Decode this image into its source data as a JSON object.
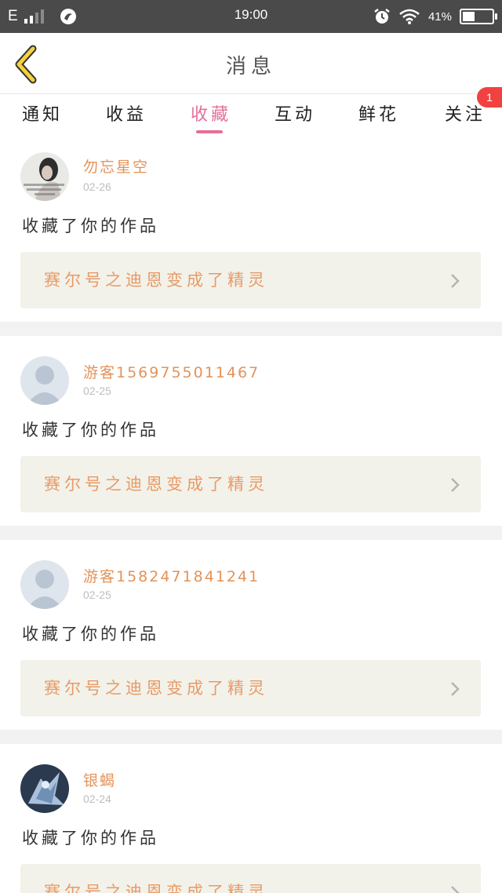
{
  "status_bar": {
    "network": "E",
    "time": "19:00",
    "battery_pct": "41%",
    "battery_level": 0.41,
    "icons": [
      "signal-icon",
      "app-icon",
      "alarm-icon",
      "wifi-icon",
      "battery-icon"
    ]
  },
  "header": {
    "title": "消息",
    "back_icon": "chevron-left-icon"
  },
  "tabs": [
    {
      "label": "通知"
    },
    {
      "label": "收益"
    },
    {
      "label": "收藏"
    },
    {
      "label": "互动"
    },
    {
      "label": "鲜花"
    },
    {
      "label": "关注"
    }
  ],
  "active_tab": "收藏",
  "badge": "1",
  "messages": [
    {
      "name": "勿忘星空",
      "date": "02-26",
      "text": "收藏了你的作品",
      "work": "赛尔号之迪恩变成了精灵"
    },
    {
      "name": "游客1569755011467",
      "date": "02-25",
      "text": "收藏了你的作品",
      "work": "赛尔号之迪恩变成了精灵"
    },
    {
      "name": "游客1582471841241",
      "date": "02-25",
      "text": "收藏了你的作品",
      "work": "赛尔号之迪恩变成了精灵"
    },
    {
      "name": "银蝎",
      "date": "02-24",
      "text": "收藏了你的作品",
      "work": "赛尔号之迪恩变成了精灵"
    }
  ],
  "colors": {
    "accent": "#e56f9c",
    "username": "#e3935a",
    "work_title": "#e89a66",
    "card_bg": "#f2f2ea",
    "badge": "#f24141",
    "back_arrow": "#f3d23a"
  }
}
